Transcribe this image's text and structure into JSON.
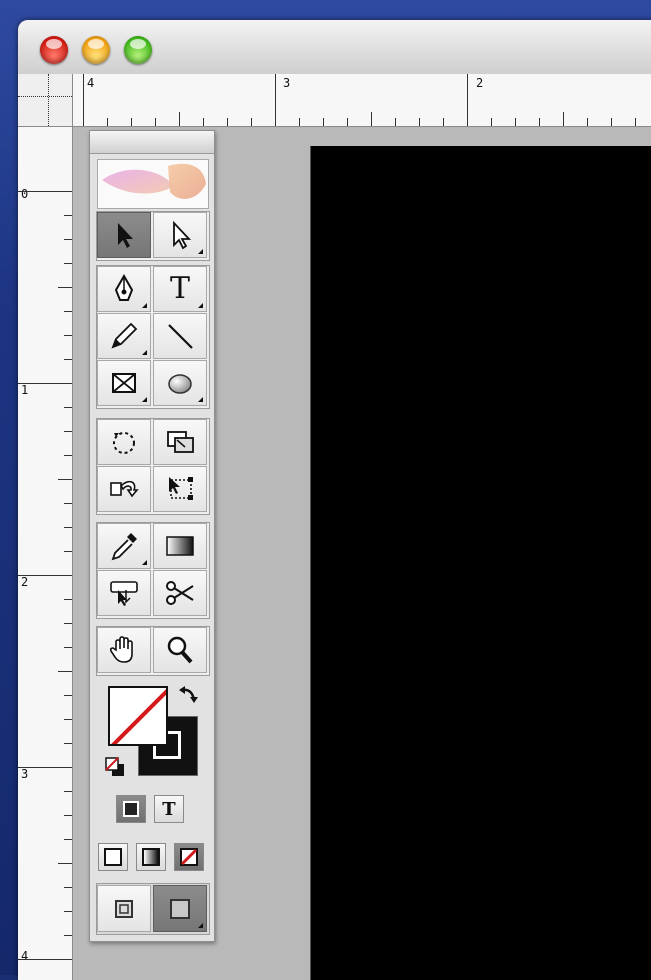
{
  "window": {
    "traffic_lights": {
      "close": "close-button",
      "minimize": "minimize-button",
      "zoom": "zoom-button"
    }
  },
  "rulers": {
    "horizontal_numbers": [
      "4",
      "3",
      "2"
    ],
    "vertical_numbers": [
      "0",
      "1",
      "2",
      "3",
      "4"
    ]
  },
  "toolbox": {
    "tools": [
      {
        "name": "selection-tool",
        "icon": "arrow-icon",
        "active": true
      },
      {
        "name": "direct-selection-tool",
        "icon": "white-arrow-icon",
        "active": false
      },
      {
        "name": "pen-tool",
        "icon": "pen-nib-icon",
        "active": false
      },
      {
        "name": "type-tool",
        "icon": "type-icon",
        "label": "T",
        "active": false
      },
      {
        "name": "pencil-tool",
        "icon": "pencil-icon",
        "active": false
      },
      {
        "name": "line-tool",
        "icon": "line-icon",
        "active": false
      },
      {
        "name": "rectangle-frame-tool",
        "icon": "frame-x-icon",
        "active": false
      },
      {
        "name": "ellipse-tool",
        "icon": "ellipse-icon",
        "active": false
      },
      {
        "name": "rotate-tool",
        "icon": "rotate-icon",
        "active": false
      },
      {
        "name": "scale-tool",
        "icon": "scale-icon",
        "active": false
      },
      {
        "name": "shear-tool",
        "icon": "shear-icon",
        "active": false
      },
      {
        "name": "free-transform-tool",
        "icon": "free-transform-icon",
        "active": false
      },
      {
        "name": "eyedropper-tool",
        "icon": "eyedropper-icon",
        "active": false
      },
      {
        "name": "gradient-tool",
        "icon": "gradient-icon",
        "active": false
      },
      {
        "name": "button-tool",
        "icon": "button-icon",
        "active": false
      },
      {
        "name": "scissors-tool",
        "icon": "scissors-icon",
        "active": false
      },
      {
        "name": "hand-tool",
        "icon": "hand-icon",
        "active": false
      },
      {
        "name": "zoom-tool",
        "icon": "magnifier-icon",
        "active": false
      }
    ],
    "formatting_text_label": "T"
  },
  "colors": {
    "page": "#000000",
    "pasteboard": "#b9b9b9",
    "none_stroke": "#d21a1a"
  }
}
